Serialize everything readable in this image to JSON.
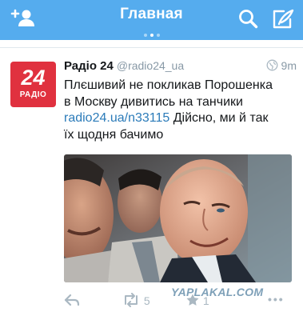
{
  "header": {
    "title": "Главная",
    "dots": [
      false,
      true,
      false
    ]
  },
  "tweet": {
    "avatar": {
      "number": "24",
      "brand": "РАДІО"
    },
    "name": "Радіо 24",
    "handle": "@radio24_ua",
    "time": "9m",
    "text_line1": "Плєшивий не покликав Порошенка",
    "text_line2": "в Москву дивитись на танчики",
    "link": "radio24.ua/n33115",
    "text_after_link": "Дійсно, ми й так",
    "text_line4": "їх щодня бачимо",
    "retweet_count": "5",
    "favorite_count": "1"
  },
  "watermark": "YAPLAKAL.COM",
  "colors": {
    "brand": "#55acee",
    "avatar": "#e0313f",
    "link": "#2b7bb9",
    "muted": "#aab8c2"
  }
}
